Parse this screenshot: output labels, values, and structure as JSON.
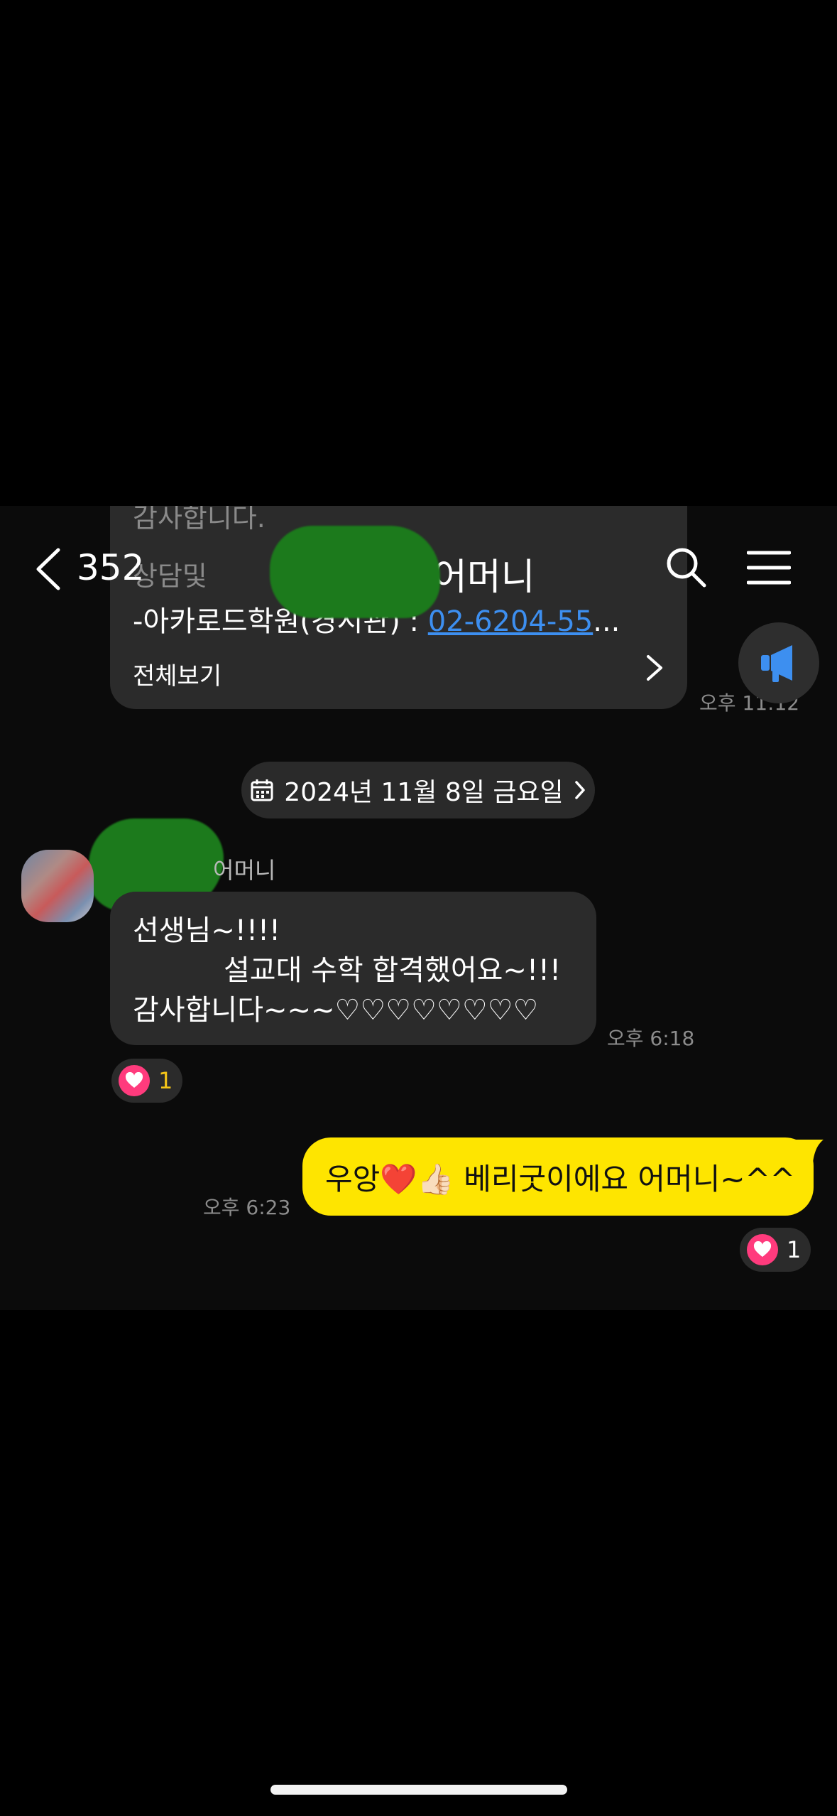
{
  "header": {
    "back_count": "352",
    "title": "어머니"
  },
  "previous_card": {
    "line_prefix": "-아카로드학원(경시관) : ",
    "phone_link": "02-6204-55",
    "ellipsis": "...",
    "view_all": "전체보기",
    "time": "오후 11:12"
  },
  "date_divider": "2024년 11월 8일 금요일",
  "incoming": {
    "sender": "어머니",
    "lines": [
      "선생님~!!!!",
      "설교대 수학 합격했어요~!!!",
      "감사합니다~~~♡♡♡♡♡♡♡♡"
    ],
    "time": "오후 6:18",
    "reaction_count": "1"
  },
  "outgoing": {
    "text": "우앙❤️👍🏻 베리굿이에요 어머니~^^",
    "time": "오후 6:23",
    "reaction_count": "1"
  },
  "colors": {
    "background": "#0b0b0b",
    "incoming_bubble": "#2b2b2b",
    "outgoing_bubble": "#fee500",
    "link": "#3d8ff0",
    "reaction_heart": "#ff3b7d",
    "notice_icon": "#3d8ff0"
  },
  "icons": [
    "back-arrow-icon",
    "search-icon",
    "menu-icon",
    "megaphone-icon",
    "calendar-icon",
    "chevron-right-icon",
    "heart-icon"
  ]
}
